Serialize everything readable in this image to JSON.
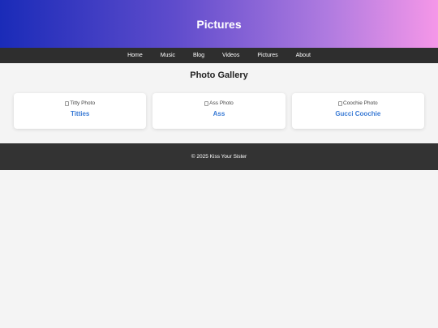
{
  "header": {
    "title": "Pictures"
  },
  "nav": {
    "items": [
      {
        "label": "Home"
      },
      {
        "label": "Music"
      },
      {
        "label": "Blog"
      },
      {
        "label": "Videos"
      },
      {
        "label": "Pictures"
      },
      {
        "label": "About"
      }
    ]
  },
  "gallery": {
    "title": "Photo Gallery",
    "cards": [
      {
        "alt": "Titty Photo",
        "title": "Titties"
      },
      {
        "alt": "Ass Photo",
        "title": "Ass"
      },
      {
        "alt": "Coochie Photo",
        "title": "Gucci Coochie"
      }
    ]
  },
  "footer": {
    "text": "© 2025 Kiss Your Sister"
  },
  "colors": {
    "header_gradient_start": "#1a2bb8",
    "header_gradient_end": "#f597e8",
    "nav_bg": "#2e2e2e",
    "card_title": "#3a7bd5",
    "footer_bg": "#333333",
    "page_bg": "#f4f4f4"
  }
}
